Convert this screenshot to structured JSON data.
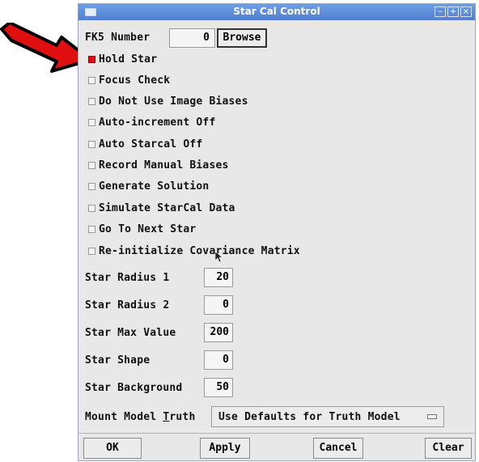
{
  "window": {
    "title": "Star Cal Control",
    "title_bar_color": "#5a8ad8"
  },
  "fk5": {
    "label": "FK5 Number",
    "value": "0",
    "browse_label": "Browse"
  },
  "checkboxes": [
    {
      "label": "Hold Star",
      "checked": true
    },
    {
      "label": "Focus Check",
      "checked": false
    },
    {
      "label": "Do Not Use Image Biases",
      "checked": false
    },
    {
      "label": "Auto-increment Off",
      "checked": false
    },
    {
      "label": "Auto Starcal Off",
      "checked": false
    },
    {
      "label": "Record Manual Biases",
      "checked": false
    },
    {
      "label": "Generate Solution",
      "checked": false
    },
    {
      "label": "Simulate StarCal Data",
      "checked": false
    },
    {
      "label": "Go To Next Star",
      "checked": false
    },
    {
      "label": "Re-initialize Covariance Matrix",
      "checked": false
    }
  ],
  "fields": {
    "star_radius_1": {
      "label": "Star Radius 1",
      "value": "20"
    },
    "star_radius_2": {
      "label": "Star Radius 2",
      "value": "0"
    },
    "star_max_value": {
      "label": "Star Max Value",
      "value": "200"
    },
    "star_shape": {
      "label": "Star Shape",
      "value": "0"
    },
    "star_background": {
      "label": "Star Background",
      "value": "50"
    }
  },
  "mount_model": {
    "label_pre": "Mount Model ",
    "label_ul": "T",
    "label_post": "ruth",
    "selected": "Use Defaults for Truth Model"
  },
  "buttons": {
    "ok": "OK",
    "apply": "Apply",
    "cancel": "Cancel",
    "clear": "Clear"
  },
  "annotation": {
    "arrow_color": "#e01010"
  }
}
